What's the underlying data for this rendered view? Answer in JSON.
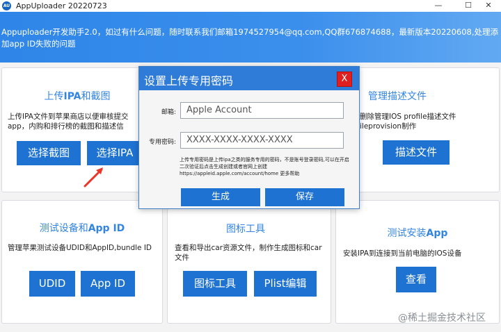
{
  "window": {
    "title": "AppUploader 20220723",
    "icon_text": "AU",
    "minimize": "—",
    "maximize": "☐",
    "close": "✕"
  },
  "banner": {
    "text": "Appuploader开发助手2.0，如过有什么问题，随时联系我们邮箱1974527954@qq.com,QQ群676874688，最新版本20220608,处理添加app ID失败的问题"
  },
  "cards": {
    "upload": {
      "title_prefix": "上传",
      "title_bold": "IPA",
      "title_suffix": "和截图",
      "desc": "上传IPA文件到苹果商店以便审核提交app，内购和排行榜的截图和描述信",
      "btn_screenshot": "选择截图",
      "btn_ipa": "选择IPA"
    },
    "profile": {
      "title": "管理描述文件",
      "desc": "删除管理IOS profile描述文件 ileprovision制作",
      "btn": "描述文件"
    },
    "devices": {
      "title_prefix": "测试设备和",
      "title_bold": "App ID",
      "desc": "管理苹果测试设备UDID和AppID,bundle ID",
      "btn_udid": "UDID",
      "btn_appid": "App ID"
    },
    "icons": {
      "title": "图标工具",
      "desc": "查看和导出car资源文件，制作生成图标和car文件",
      "btn_icon": "图标工具",
      "btn_plist": "Plist编辑"
    },
    "install": {
      "title_prefix": "测试安装",
      "title_bold": "App",
      "desc": "安装IPA到连接到当前电脑的IOS设备",
      "btn": "查看"
    }
  },
  "modal": {
    "title": "设置上传专用密码",
    "close": "X",
    "email_label": "邮箱:",
    "email_placeholder": "Apple Account",
    "password_label": "专用密码:",
    "password_placeholder": "XXXX-XXXX-XXXX-XXXX",
    "hint": "上传专用密码是上传ipa之类的服务专用的密码，不是账号登录密码,可以在开启二次验证后点击生成创建或者官网上创建https://appleid.apple.com/account/home 更多帮助",
    "btn_generate": "生成",
    "btn_save": "保存"
  },
  "watermark": "@稀土掘金技术社区",
  "colors": {
    "banner": "#2f86e8",
    "button": "#1e73d2",
    "title_accent": "#3385e0",
    "modal_header": "#2f7bd8",
    "close_red": "#e02020",
    "arrow_red": "#e8362a"
  }
}
